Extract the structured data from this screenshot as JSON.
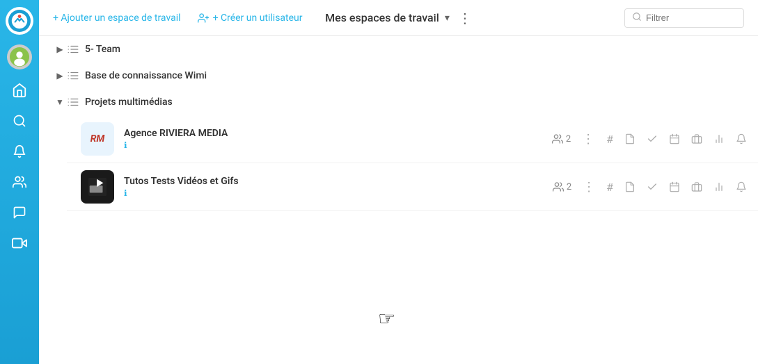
{
  "sidebar": {
    "logo_alt": "Wimi logo",
    "icons": [
      {
        "name": "home-icon",
        "glyph": "⌂",
        "label": "Home"
      },
      {
        "name": "search-icon",
        "glyph": "🔍",
        "label": "Search"
      },
      {
        "name": "bell-icon",
        "glyph": "🔔",
        "label": "Notifications"
      },
      {
        "name": "contacts-icon",
        "glyph": "👤",
        "label": "Contacts"
      },
      {
        "name": "chat-icon",
        "glyph": "💬",
        "label": "Chat"
      },
      {
        "name": "video-icon",
        "glyph": "📹",
        "label": "Video"
      }
    ]
  },
  "toolbar": {
    "add_workspace_label": "+ Ajouter un espace de travail",
    "create_user_label": "+ Créer un utilisateur",
    "title": "Mes espaces de travail",
    "filter_placeholder": "Filtrer"
  },
  "workspace_list": {
    "items": [
      {
        "id": "team",
        "label": "5- Team",
        "collapsed": true,
        "expanded": false
      },
      {
        "id": "knowledge",
        "label": "Base de connaissance Wimi",
        "collapsed": true,
        "expanded": false
      },
      {
        "id": "multimedia",
        "label": "Projets multimédias",
        "collapsed": false,
        "expanded": true
      }
    ],
    "sub_items": [
      {
        "id": "riviera",
        "name": "Agence RIVIERA MEDIA",
        "logo_type": "rm",
        "logo_text": "RM",
        "user_count": "2",
        "info_icon": "ℹ"
      },
      {
        "id": "tutos",
        "name": "Tutos Tests Vidéos et Gifs",
        "logo_type": "video",
        "user_count": "2",
        "info_icon": "ℹ"
      }
    ],
    "action_icons": {
      "users": "👥",
      "more": "⋮",
      "hash": "#",
      "file": "📄",
      "check": "✓",
      "calendar": "📅",
      "briefcase": "💼",
      "chart": "📊",
      "bell": "🔔"
    }
  }
}
